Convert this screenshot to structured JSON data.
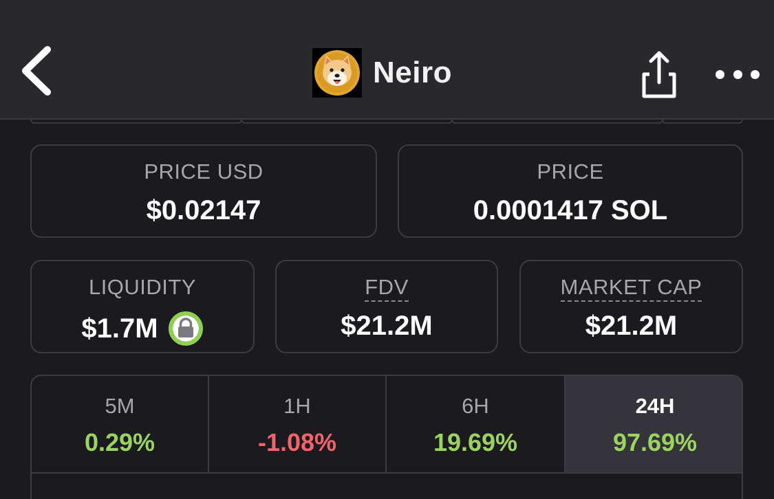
{
  "header": {
    "title": "Neiro",
    "logo_icon": "shiba-dog-logo",
    "back_icon": "chevron-left-icon",
    "share_icon": "share-icon",
    "more_icon": "more-horizontal-icon"
  },
  "stats_row1": [
    {
      "label": "PRICE USD",
      "value": "$0.02147"
    },
    {
      "label": "PRICE",
      "value": "0.0001417 SOL"
    }
  ],
  "stats_row2": [
    {
      "label": "LIQUIDITY",
      "value": "$1.7M",
      "icon": "lock-icon"
    },
    {
      "label": "FDV",
      "value": "$21.2M"
    },
    {
      "label": "MARKET CAP",
      "value": "$21.2M"
    }
  ],
  "timeframes": [
    {
      "label": "5M",
      "value": "0.29%",
      "trend": "up"
    },
    {
      "label": "1H",
      "value": "-1.08%",
      "trend": "down"
    },
    {
      "label": "6H",
      "value": "19.69%",
      "trend": "up"
    },
    {
      "label": "24H",
      "value": "97.69%",
      "trend": "up",
      "active": true
    }
  ],
  "colors": {
    "positive": "#9bd35f",
    "negative": "#f2636b",
    "background": "#1b1b1f",
    "navbar": "#28282d",
    "card_border": "#3b3b42",
    "lock_ring": "#8fd14f"
  }
}
